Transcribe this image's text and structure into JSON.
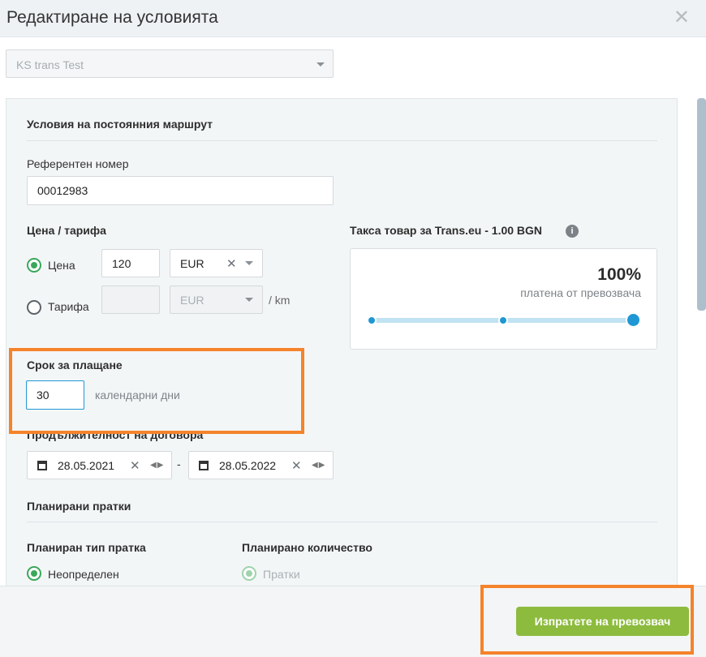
{
  "header": {
    "title": "Редактиране на условията",
    "close_symbol": "✕"
  },
  "company_select": {
    "value": "KS trans Test"
  },
  "section_fixed_route": {
    "title": "Условия на постоянния маршрут"
  },
  "reference": {
    "label": "Референтен номер",
    "value": "00012983"
  },
  "price_tariff": {
    "title": "Цена / тарифа",
    "price_option": {
      "label": "Цена",
      "selected": true,
      "amount": "120",
      "currency": "EUR"
    },
    "tariff_option": {
      "label": "Тарифа",
      "selected": false,
      "amount": "",
      "currency": "EUR",
      "unit": "/ km"
    }
  },
  "fee": {
    "title": "Такса товар за Trans.eu - 1.00 BGN",
    "percent": "100%",
    "paid_by": "платена от превозвача",
    "slider_value_fraction": 1.0
  },
  "payment_term": {
    "title": "Срок за плащане",
    "value": "30",
    "unit": "календарни дни"
  },
  "contract_duration": {
    "title": "Продължителност на договора",
    "from": "28.05.2021",
    "separator": "-",
    "to": "28.05.2022"
  },
  "planned_shipments": {
    "title": "Планирани пратки",
    "type_title": "Планиран тип пратка",
    "type_option": "Неопределен",
    "quantity_title": "Планирано количество",
    "quantity_option": "Пратки"
  },
  "footer": {
    "send_button": "Изпратете на превозвач"
  },
  "colors": {
    "accent_green": "#3aa85b",
    "button_green": "#8dbb3e",
    "highlight_orange": "#f5832a",
    "slider_blue": "#1f97d4"
  }
}
